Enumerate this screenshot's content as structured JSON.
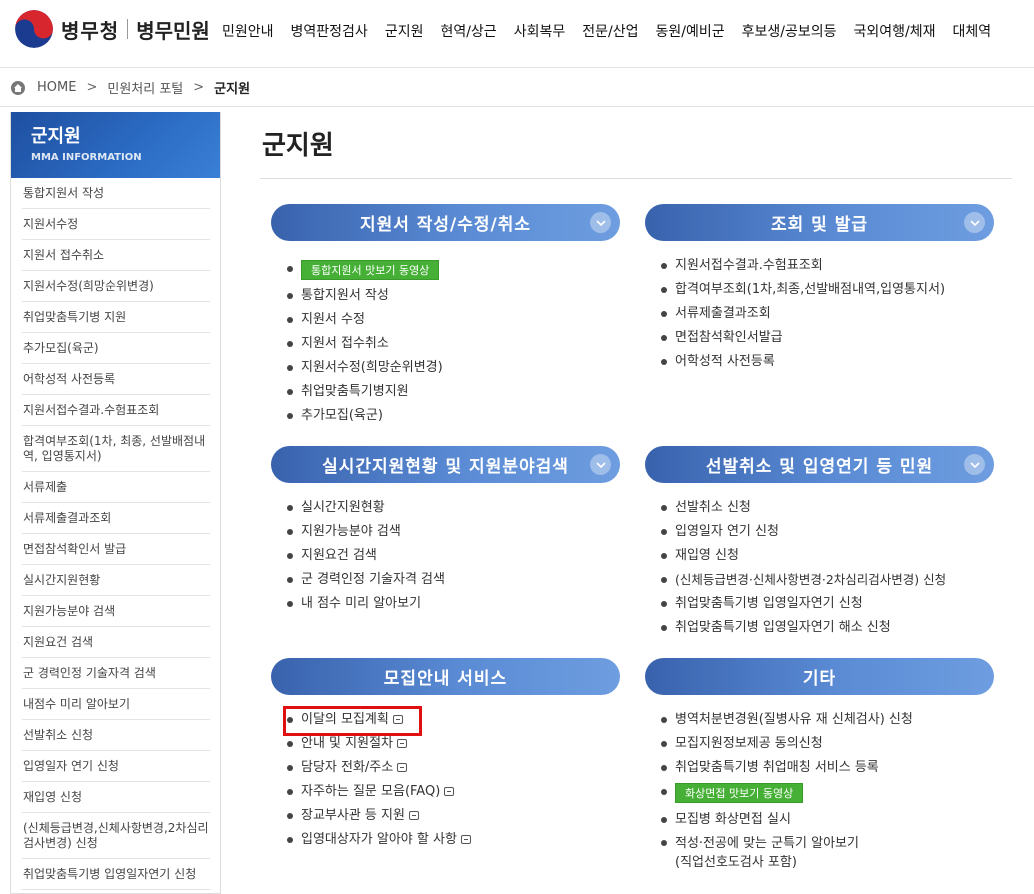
{
  "header": {
    "logo_text": "병무청",
    "logo_sub": "병무민원",
    "nav": [
      "민원안내",
      "병역판정검사",
      "군지원",
      "현역/상근",
      "사회복무",
      "전문/산업",
      "동원/예비군",
      "후보생/공보의등",
      "국외여행/체재",
      "대체역"
    ]
  },
  "breadcrumb": {
    "home": "HOME",
    "level1": "민원처리 포털",
    "current": "군지원"
  },
  "sidebar": {
    "title": "군지원",
    "subtitle": "MMA INFORMATION",
    "items": [
      "통합지원서 작성",
      "지원서수정",
      "지원서 접수취소",
      "지원서수정(희망순위변경)",
      "취업맞춤특기병 지원",
      "추가모집(육군)",
      "어학성적 사전등록",
      "지원서접수결과.수험표조회",
      "합격여부조회(1차, 최종, 선발배점내역, 입영통지서)",
      "서류제출",
      "서류제출결과조회",
      "면접참석확인서 발급",
      "실시간지원현황",
      "지원가능분야 검색",
      "지원요건 검색",
      "군 경력인정 기술자격 검색",
      "내점수 미리 알아보기",
      "선발취소 신청",
      "입영일자 연기 신청",
      "재입영 신청",
      "(신체등급변경,신체사항변경,2차심리검사변경) 신청",
      "취업맞춤특기병 입영일자연기 신청"
    ]
  },
  "main": {
    "title": "군지원",
    "sections": {
      "apply": {
        "title": "지원서 작성/수정/취소",
        "video_button": "통합지원서 맛보기 동영상",
        "items": [
          "통합지원서 작성",
          "지원서 수정",
          "지원서 접수취소",
          "지원서수정(희망순위변경)",
          "취업맞춤특기병지원",
          "추가모집(육군)"
        ]
      },
      "inquiry": {
        "title": "조회 및 발급",
        "items": [
          "지원서접수결과.수험표조회",
          "합격여부조회(1차,최종,선발배점내역,입영통지서)",
          "서류제출결과조회",
          "면접참석확인서발급",
          "어학성적 사전등록"
        ]
      },
      "realtime": {
        "title": "실시간지원현황 및 지원분야검색",
        "items": [
          "실시간지원현황",
          "지원가능분야 검색",
          "지원요건 검색",
          "군 경력인정 기술자격 검색",
          "내 점수 미리 알아보기"
        ]
      },
      "cancel": {
        "title": "선발취소 및 입영연기 등 민원",
        "items": [
          "선발취소 신청",
          "입영일자 연기 신청",
          "재입영 신청",
          "(신체등급변경·신체사항변경·2차심리검사변경) 신청",
          "취업맞춤특기병 입영일자연기 신청",
          "취업맞춤특기병 입영일자연기 해소 신청"
        ]
      },
      "recruit": {
        "title": "모집안내 서비스",
        "items": [
          "이달의 모집계획",
          "안내 및 지원절차",
          "담당자 전화/주소",
          "자주하는 질문 모음(FAQ)",
          "장교부사관 등 지원",
          "입영대상자가 알아야 할 사항"
        ]
      },
      "etc": {
        "title": "기타",
        "video_button": "화상면접 맛보기 동영상",
        "items": [
          "병역처분변경원(질병사유 재 신체검사) 신청",
          "모집지원정보제공 동의신청",
          "취업맞춤특기병 취업매칭 서비스 등록",
          "모집병 화상면접 실시",
          "적성·전공에 맞는 군특기 알아보기",
          "(직업선호도검사 포함)"
        ]
      }
    }
  },
  "colors": {
    "accent_blue": "#3962ad",
    "green_button": "#45b035",
    "highlight_red": "#e01010"
  }
}
